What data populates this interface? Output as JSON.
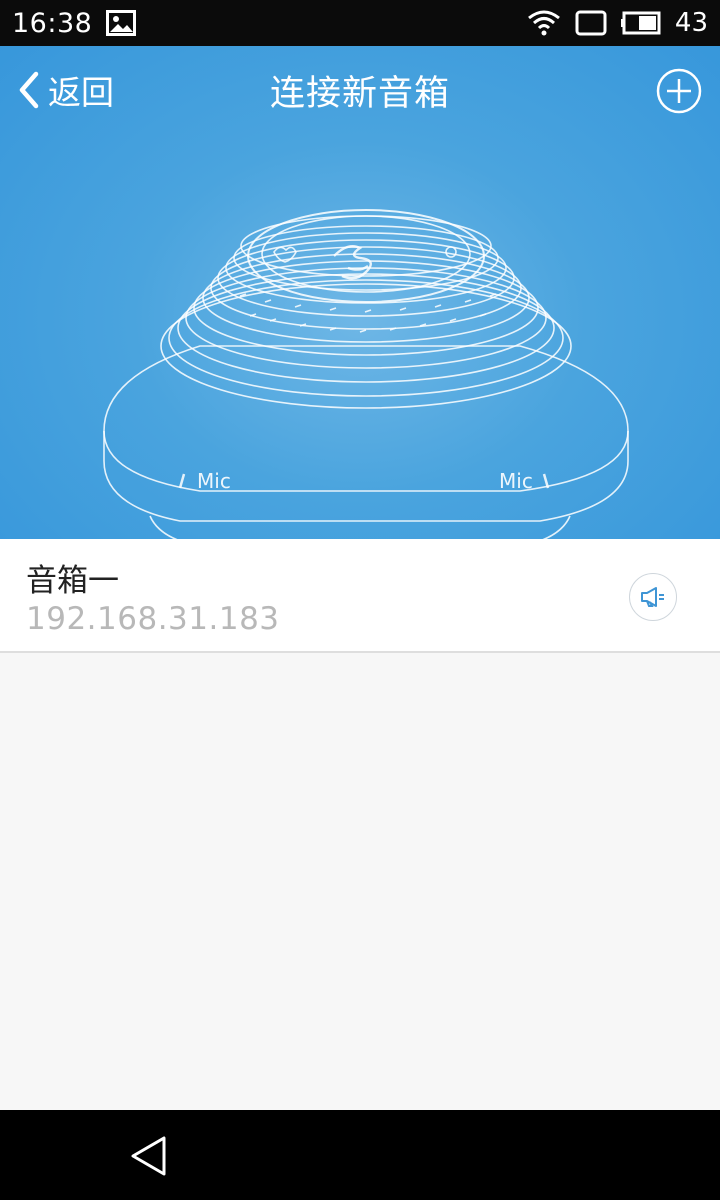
{
  "status_bar": {
    "time": "16:38",
    "battery_level": "43",
    "icons": [
      "image-icon",
      "wifi-icon",
      "screen-rotation-icon",
      "battery-icon"
    ]
  },
  "header": {
    "back_label": "返回",
    "title": "连接新音箱",
    "add_icon": "plus-circle-icon",
    "hero_labels": {
      "mic_left": "Mic",
      "mic_right": "Mic"
    }
  },
  "devices": [
    {
      "name": "音箱一",
      "ip": "192.168.31.183",
      "action_icon": "speaker-icon"
    }
  ],
  "colors": {
    "header_blue": "#3797db",
    "status_bar": "#0b0b0b",
    "list_bg": "#f7f7f7",
    "ip_gray": "#b8b8b8"
  },
  "system_nav": {
    "back_icon": "triangle-back-icon"
  }
}
